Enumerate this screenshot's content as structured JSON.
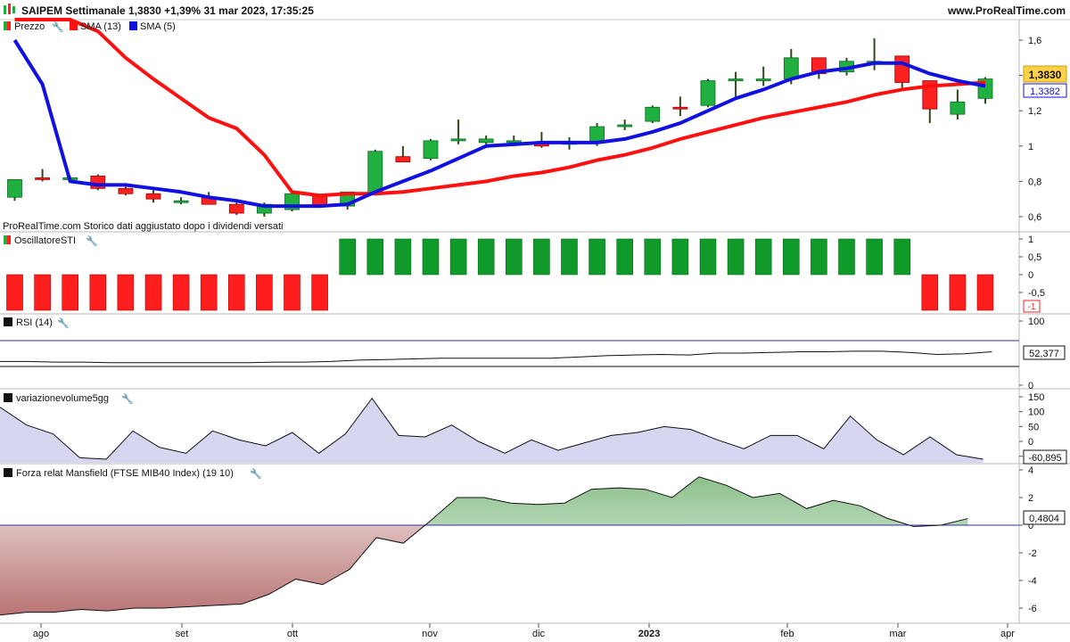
{
  "header": {
    "title": "SAIPEM Settimanale 1,3830 +1,39% 31 mar 2023, 17:35:25",
    "site": "www.ProRealTime.com"
  },
  "price_panel": {
    "legend": [
      "Prezzo",
      "SMA (13)",
      "SMA (5)"
    ],
    "note": "ProRealTime.com  Storico dati aggiustato dopo i dividendi versati",
    "last_price": "1,3830",
    "sma5_last": "1,3382",
    "y_ticks": [
      "1,6",
      "1,4",
      "1,2",
      "1",
      "0,8",
      "0,6"
    ]
  },
  "sti_panel": {
    "title": "OscillatoreSTI",
    "y_ticks": [
      "1",
      "0,5",
      "0",
      "-0,5"
    ],
    "last_value": "-1"
  },
  "rsi_panel": {
    "title": "RSI (14)",
    "y_ticks": [
      "100",
      "0"
    ],
    "last_value": "52,377"
  },
  "vol_panel": {
    "title": "variazionevolume5gg",
    "y_ticks": [
      "150",
      "100",
      "50",
      "0",
      "-50"
    ],
    "last_value": "-60,895"
  },
  "mans_panel": {
    "title": "Forza relat Mansfield (FTSE MIB40 Index) (19 10)",
    "y_ticks": [
      "4",
      "2",
      "0",
      "-2",
      "-4",
      "-6"
    ],
    "last_value": "0,4804"
  },
  "x_labels": [
    "ago",
    "set",
    "ott",
    "nov",
    "dic",
    "2023",
    "feb",
    "mar",
    "apr"
  ],
  "colors": {
    "up": "#1fb040",
    "down": "#ff2020",
    "sma13": "#ff1010",
    "sma5": "#1010e0",
    "sti_up": "#0f9a2a",
    "sti_down": "#ff1e1e",
    "last_price_bg": "#ffd24a"
  },
  "chart_data": [
    {
      "type": "candlestick",
      "name": "price",
      "title": "SAIPEM Settimanale",
      "ylim": [
        0.55,
        1.67
      ],
      "candles": [
        {
          "o": 0.71,
          "h": 0.81,
          "l": 0.69,
          "c": 0.81
        },
        {
          "o": 0.82,
          "h": 0.87,
          "l": 0.8,
          "c": 0.81
        },
        {
          "o": 0.82,
          "h": 0.83,
          "l": 0.81,
          "c": 0.82
        },
        {
          "o": 0.83,
          "h": 0.84,
          "l": 0.75,
          "c": 0.76
        },
        {
          "o": 0.76,
          "h": 0.79,
          "l": 0.72,
          "c": 0.73
        },
        {
          "o": 0.73,
          "h": 0.75,
          "l": 0.68,
          "c": 0.7
        },
        {
          "o": 0.69,
          "h": 0.71,
          "l": 0.67,
          "c": 0.69
        },
        {
          "o": 0.71,
          "h": 0.74,
          "l": 0.67,
          "c": 0.67
        },
        {
          "o": 0.67,
          "h": 0.68,
          "l": 0.61,
          "c": 0.62
        },
        {
          "o": 0.62,
          "h": 0.68,
          "l": 0.6,
          "c": 0.67
        },
        {
          "o": 0.64,
          "h": 0.74,
          "l": 0.63,
          "c": 0.73
        },
        {
          "o": 0.72,
          "h": 0.73,
          "l": 0.65,
          "c": 0.66
        },
        {
          "o": 0.66,
          "h": 0.74,
          "l": 0.64,
          "c": 0.74
        },
        {
          "o": 0.73,
          "h": 0.98,
          "l": 0.72,
          "c": 0.97
        },
        {
          "o": 0.94,
          "h": 1.0,
          "l": 0.91,
          "c": 0.91
        },
        {
          "o": 0.93,
          "h": 1.04,
          "l": 0.92,
          "c": 1.03
        },
        {
          "o": 1.03,
          "h": 1.15,
          "l": 1.01,
          "c": 1.04
        },
        {
          "o": 1.02,
          "h": 1.06,
          "l": 0.99,
          "c": 1.04
        },
        {
          "o": 1.02,
          "h": 1.06,
          "l": 1.0,
          "c": 1.03
        },
        {
          "o": 1.02,
          "h": 1.08,
          "l": 0.99,
          "c": 1.0
        },
        {
          "o": 1.01,
          "h": 1.05,
          "l": 0.98,
          "c": 1.02
        },
        {
          "o": 1.02,
          "h": 1.13,
          "l": 1.0,
          "c": 1.11
        },
        {
          "o": 1.11,
          "h": 1.15,
          "l": 1.09,
          "c": 1.12
        },
        {
          "o": 1.14,
          "h": 1.23,
          "l": 1.13,
          "c": 1.22
        },
        {
          "o": 1.22,
          "h": 1.28,
          "l": 1.17,
          "c": 1.21
        },
        {
          "o": 1.23,
          "h": 1.38,
          "l": 1.22,
          "c": 1.37
        },
        {
          "o": 1.38,
          "h": 1.42,
          "l": 1.28,
          "c": 1.38
        },
        {
          "o": 1.38,
          "h": 1.45,
          "l": 1.34,
          "c": 1.38
        },
        {
          "o": 1.38,
          "h": 1.55,
          "l": 1.35,
          "c": 1.5
        },
        {
          "o": 1.5,
          "h": 1.5,
          "l": 1.38,
          "c": 1.41
        },
        {
          "o": 1.42,
          "h": 1.5,
          "l": 1.4,
          "c": 1.48
        },
        {
          "o": 1.48,
          "h": 1.61,
          "l": 1.43,
          "c": 1.48
        },
        {
          "o": 1.51,
          "h": 1.51,
          "l": 1.32,
          "c": 1.36
        },
        {
          "o": 1.37,
          "h": 1.37,
          "l": 1.13,
          "c": 1.21
        },
        {
          "o": 1.18,
          "h": 1.32,
          "l": 1.15,
          "c": 1.25
        },
        {
          "o": 1.27,
          "h": 1.39,
          "l": 1.24,
          "c": 1.38
        }
      ],
      "sma13": [
        1.95,
        1.9,
        1.8,
        1.65,
        1.5,
        1.38,
        1.27,
        1.16,
        1.1,
        0.95,
        0.74,
        0.72,
        0.73,
        0.73,
        0.74,
        0.76,
        0.78,
        0.8,
        0.83,
        0.85,
        0.88,
        0.92,
        0.95,
        0.99,
        1.04,
        1.08,
        1.12,
        1.16,
        1.19,
        1.22,
        1.25,
        1.29,
        1.32,
        1.34,
        1.35,
        1.36
      ],
      "sma5": [
        1.6,
        1.35,
        0.8,
        0.78,
        0.78,
        0.76,
        0.74,
        0.71,
        0.69,
        0.66,
        0.66,
        0.66,
        0.67,
        0.74,
        0.8,
        0.86,
        0.93,
        1.0,
        1.01,
        1.02,
        1.02,
        1.02,
        1.04,
        1.08,
        1.13,
        1.2,
        1.27,
        1.32,
        1.38,
        1.42,
        1.44,
        1.47,
        1.47,
        1.41,
        1.37,
        1.34
      ]
    },
    {
      "type": "bar",
      "name": "OscillatoreSTI",
      "ylim": [
        -1,
        1
      ],
      "values": [
        -1,
        -1,
        -1,
        -1,
        -1,
        -1,
        -1,
        -1,
        -1,
        -1,
        -1,
        -1,
        1,
        1,
        1,
        1,
        1,
        1,
        1,
        1,
        1,
        1,
        1,
        1,
        1,
        1,
        1,
        1,
        1,
        1,
        1,
        1,
        1,
        -1,
        -1,
        -1
      ]
    },
    {
      "type": "line",
      "name": "RSI (14)",
      "ylim": [
        0,
        100
      ],
      "values": [
        37,
        37,
        36,
        36,
        35,
        35,
        35,
        35,
        35,
        35,
        36,
        36,
        37,
        39,
        40,
        41,
        42,
        42,
        42,
        42,
        42,
        44,
        46,
        47,
        48,
        47,
        50,
        50,
        51,
        52,
        52,
        53,
        53,
        51,
        48,
        49,
        52
      ]
    },
    {
      "type": "area",
      "name": "variazionevolume5gg",
      "ylim": [
        -70,
        160
      ],
      "values": [
        115,
        55,
        25,
        -55,
        -60,
        35,
        -20,
        -40,
        35,
        5,
        -15,
        30,
        -40,
        25,
        145,
        20,
        15,
        55,
        0,
        -40,
        5,
        -30,
        -5,
        20,
        30,
        50,
        40,
        5,
        -25,
        20,
        20,
        -25,
        85,
        5,
        -45,
        15,
        -45,
        -60
      ]
    },
    {
      "type": "area",
      "name": "Forza relat Mansfield",
      "ylim": [
        -6.6,
        4.6
      ],
      "values": [
        -6.5,
        -6.3,
        -6.3,
        -6.1,
        -6.2,
        -6.0,
        -6.0,
        -5.9,
        -5.8,
        -5.7,
        -5.0,
        -3.9,
        -4.3,
        -3.2,
        -0.9,
        -1.3,
        0.3,
        2.0,
        2.0,
        1.6,
        1.5,
        1.6,
        2.6,
        2.7,
        2.6,
        2.0,
        3.5,
        2.9,
        2.0,
        2.3,
        1.2,
        1.8,
        1.4,
        0.5,
        -0.1,
        0.0,
        0.48
      ]
    }
  ]
}
